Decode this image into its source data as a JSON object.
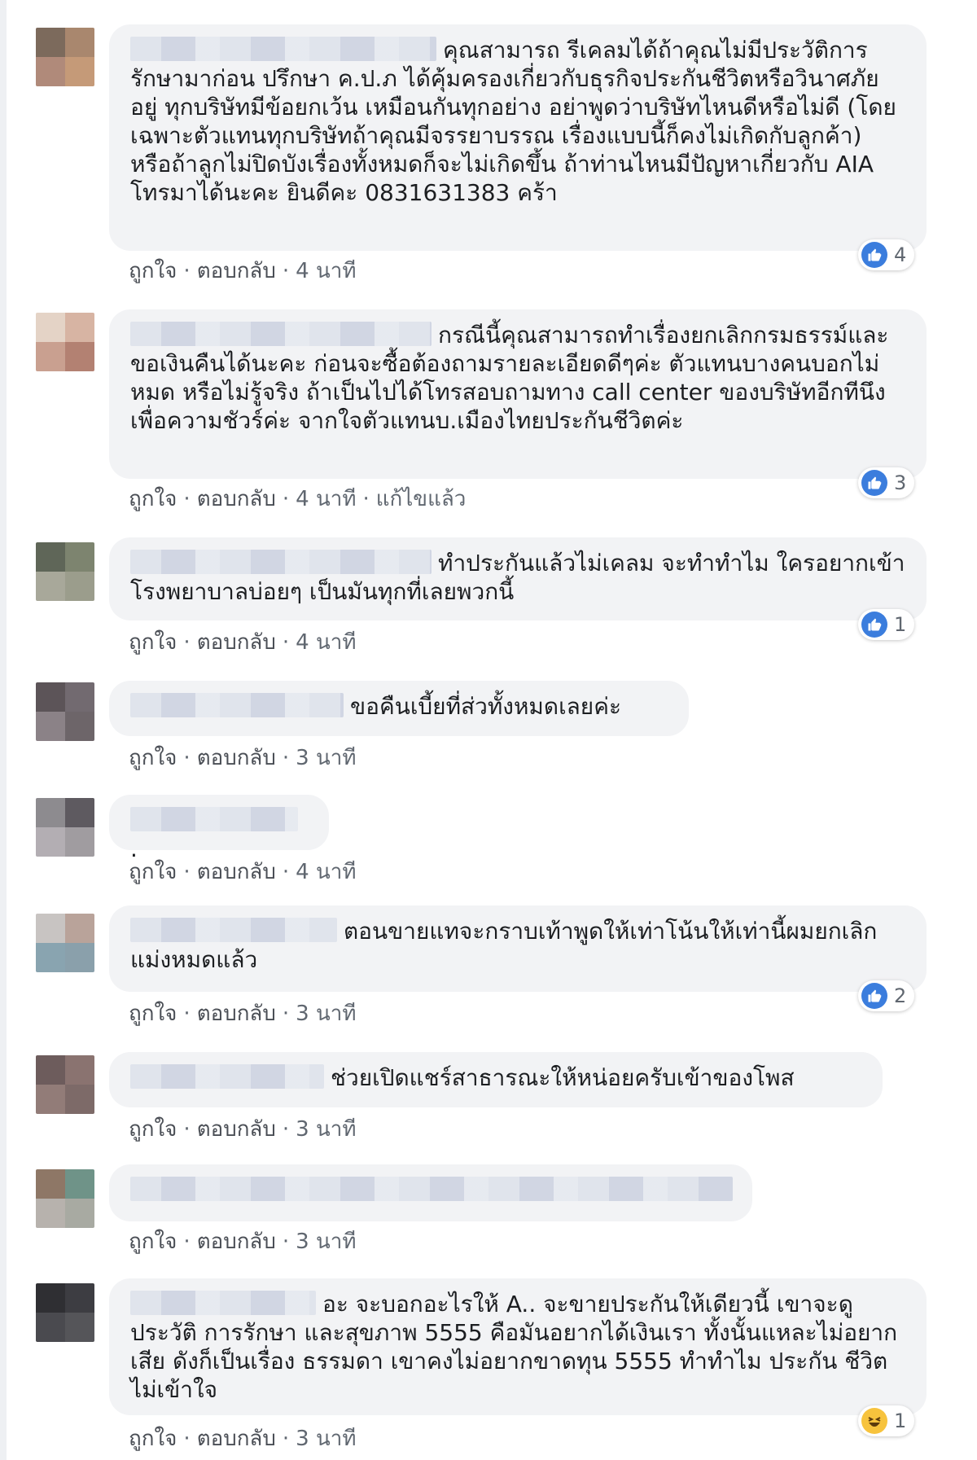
{
  "actions": {
    "like": "ถูกใจ",
    "reply": "ตอบกลับ",
    "sep": "·",
    "edited": "แก้ไขแล้ว"
  },
  "comments": [
    {
      "text": "คุณสามารถ รีเคลมได้ถ้าคุณไม่มีประวัติการรักษามาก่อน ปรึกษา ค.ป.ภ ได้คุ้มครองเกี่ยวกับธุรกิจประกันชีวิตหรือวินาศภัยอยู่ ทุกบริษัทมีข้อยกเว้น เหมือนกันทุกอย่าง อย่าพูดว่าบริษัทไหนดีหรือไม่ดี (โดยเฉพาะตัวแทนทุกบริษัทถ้าคุณมีจรรยาบรรณ เรื่องแบบนี้ก็คงไม่เกิดกับลูกค้า) หรือถ้าลูกไม่ปิดบังเรื่องทั้งหมดก็จะไม่เกิดขึ้น ถ้าท่านไหนมีปัญหาเกี่ยวกับ AIA โทรมาได้นะคะ ยินดีคะ 0831631383 คร้า",
      "time": "4 นาที",
      "reaction": {
        "type": "like",
        "count": "4"
      },
      "avatar_colors": [
        "#7c6a5c",
        "#a9876e",
        "#b08a7a",
        "#c59a78"
      ]
    },
    {
      "text": "กรณีนี้คุณสามารถทำเรื่องยกเลิกกรมธรรม์และขอเงินคืนได้นะคะ ก่อนจะซื้อต้องถามรายละเอียดดีๆค่ะ ตัวแทนบางคนบอกไม่หมด หรือไม่รู้จริง ถ้าเป็นไปได้โทรสอบถามทาง call center ของบริษัทอีกทีนึงเพื่อความชัวร์ค่ะ จากใจตัวแทนบ.เมืองไทยประกันชีวิตค่ะ",
      "time": "4 นาที",
      "edited": true,
      "reaction": {
        "type": "like",
        "count": "3"
      },
      "avatar_colors": [
        "#e4d3c6",
        "#d7b4a3",
        "#c9a090",
        "#b38172"
      ]
    },
    {
      "text": "ทำประกันแล้วไม่เคลม จะทำทำไม ใครอยากเข้าโรงพยาบาลบ่อยๆ เป็นมันทุกที่เลยพวกนี้",
      "time": "4 นาที",
      "reaction": {
        "type": "like",
        "count": "1"
      },
      "avatar_colors": [
        "#5f6658",
        "#7d846f",
        "#a8a89a",
        "#9b9d8c"
      ]
    },
    {
      "text": "ขอคืนเบี้ยที่ส่วทั้งหมดเลยค่ะ",
      "time": "3 นาที",
      "avatar_colors": [
        "#5c5458",
        "#726a70",
        "#8b8287",
        "#6d6569"
      ]
    },
    {
      "text": ".",
      "time": "4 นาที",
      "avatar_colors": [
        "#8d8b8f",
        "#5e5a60",
        "#b3aeb3",
        "#a09ca0"
      ]
    },
    {
      "text": "ตอนขายแทจะกราบเท้าพูดให้เท่าโน้นให้เท่านี้ผมยกเลิกแม่งหมดแล้ว",
      "time": "3 นาที",
      "reaction": {
        "type": "like",
        "count": "2"
      },
      "avatar_colors": [
        "#c8c4c2",
        "#b9a39a",
        "#89a4b0",
        "#8aa0ab"
      ]
    },
    {
      "text": "ช่วยเปิดแชร์สาธารณะให้หน่อยครับเข้าของโพส",
      "time": "3 นาที",
      "avatar_colors": [
        "#6d5c5c",
        "#8a7370",
        "#927c78",
        "#7d6a68"
      ]
    },
    {
      "text": "",
      "time": "3 นาที",
      "avatar_colors": [
        "#8e7766",
        "#6f9388",
        "#b7b2ad",
        "#a8aaa2"
      ]
    },
    {
      "text": "อะ จะบอกอะไรให้ A.. จะขายประกันให้เดียวนี้ เขาจะดูประวัติ การรักษา และสุขภาพ 5555 คือมันอยากได้เงินเรา ทั้งนั้นแหละไม่อยากเสีย ดังก็เป็นเรื่อง ธรรมดา เขาคงไม่อยากขาดทุน 5555 ทำทำไม ประกัน ชีวิต ไม่เข้าใจ",
      "time": "3 นาที",
      "reaction": {
        "type": "haha",
        "count": "1"
      },
      "avatar_colors": [
        "#2f2f33",
        "#3d3d42",
        "#4a4a4f",
        "#555559"
      ]
    }
  ]
}
